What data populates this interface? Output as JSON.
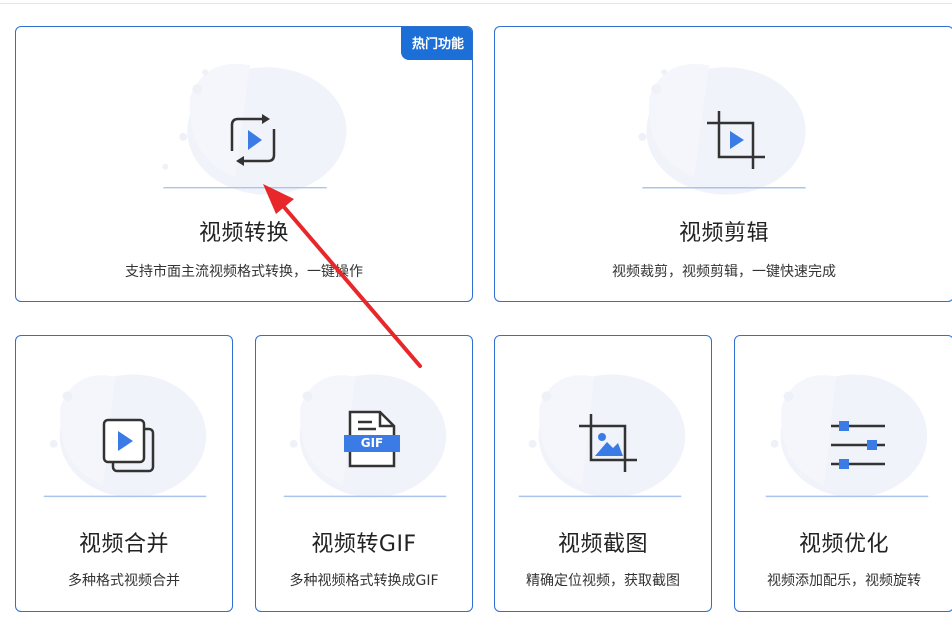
{
  "cards": {
    "convert": {
      "title": "视频转换",
      "desc": "支持市面主流视频格式转换，一键操作",
      "badge": "热门功能",
      "icon": "convert-icon"
    },
    "edit": {
      "title": "视频剪辑",
      "desc": "视频裁剪，视频剪辑，一键快速完成",
      "icon": "crop-icon"
    },
    "merge": {
      "title": "视频合并",
      "desc": "多种格式视频合并",
      "icon": "merge-icon"
    },
    "gif": {
      "title": "视频转GIF",
      "desc": "多种视频格式转换成GIF",
      "icon": "gif-file-icon",
      "icon_label": "GIF"
    },
    "screenshot": {
      "title": "视频截图",
      "desc": "精确定位视频，获取截图",
      "icon": "crop-image-icon"
    },
    "optimize": {
      "title": "视频优化",
      "desc": "视频添加配乐，视频旋转",
      "icon": "sliders-icon"
    }
  },
  "colors": {
    "accent": "#2f6fd0",
    "badge": "#1b6fd6",
    "icon_blue": "#3b7be6",
    "annotation_arrow": "#e8272a"
  }
}
